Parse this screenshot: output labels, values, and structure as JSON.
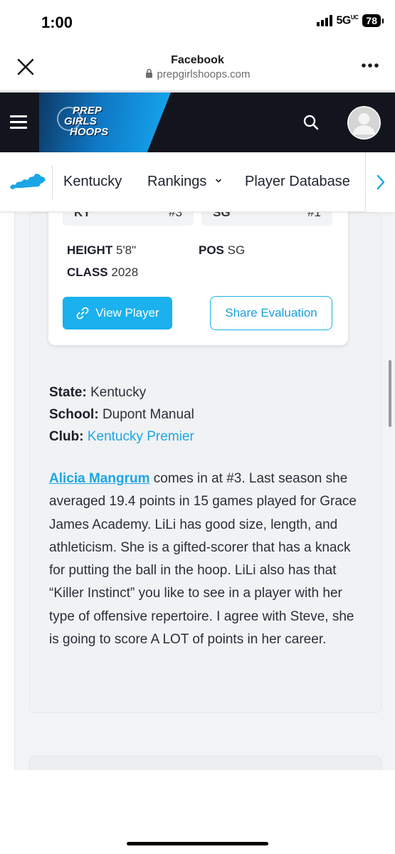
{
  "status_bar": {
    "time": "1:00",
    "network": "5G",
    "network_sup": "UC",
    "battery": "78"
  },
  "browser": {
    "title": "Facebook",
    "url": "prepgirlshoops.com"
  },
  "site_header": {
    "logo_lines": [
      "PREP",
      "GIRLS",
      "HOOPS"
    ],
    "accent_color": "#1ab1ee"
  },
  "nav": {
    "items": [
      {
        "label": "Kentucky"
      },
      {
        "label": "Rankings"
      },
      {
        "label": "Player Database"
      }
    ]
  },
  "player_card": {
    "top_stats": [
      {
        "left": "KY",
        "right": "#3"
      },
      {
        "left": "SG",
        "right": "#1"
      }
    ],
    "height_label": "HEIGHT",
    "height_value": "5'8\"",
    "class_label": "CLASS",
    "class_value": "2028",
    "pos_label": "POS",
    "pos_value": "SG",
    "view_button": "View Player",
    "share_button": "Share Evaluation"
  },
  "details": {
    "state_label": "State:",
    "state_value": "Kentucky",
    "school_label": "School:",
    "school_value": "Dupont Manual",
    "club_label": "Club:",
    "club_value": "Kentucky Premier"
  },
  "evaluation": {
    "player_name": "Alicia Mangrum",
    "text": " comes in at #3. Last season she averaged 19.4 points in 15 games played for Grace James Academy. LiLi has good size, length, and athleticism. She is a gifted-scorer that has a knack for putting the ball in the hoop. LiLi also has that “Killer Instinct” you like to see in a player with her type of offensive repertoire. I agree with Steve, she is going to score A LOT of points in her career."
  }
}
